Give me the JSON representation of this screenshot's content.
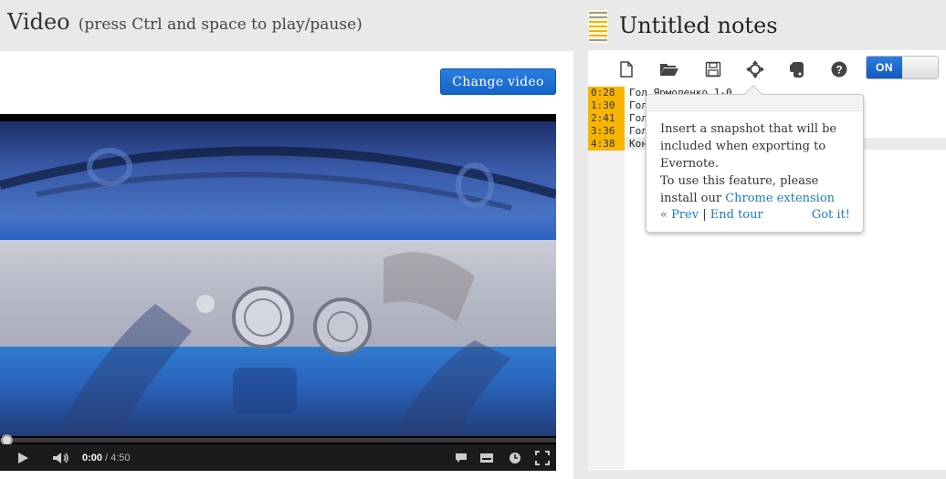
{
  "video": {
    "heading": "Video",
    "hint": "(press Ctrl and space to play/pause)",
    "change_button": "Change video",
    "player": {
      "progress": 0.0,
      "time_current": "0:00",
      "time_separator": "/",
      "time_total": "4:50",
      "icons": [
        "play-icon",
        "volume-icon",
        "captions-icon",
        "subtitles-icon",
        "settings-icon",
        "fullscreen-icon"
      ]
    }
  },
  "notes": {
    "title": "Untitled notes",
    "toolbar": {
      "icons": [
        "new-file-icon",
        "open-folder-icon",
        "save-icon",
        "snapshot-icon",
        "evernote-icon",
        "help-icon"
      ],
      "toggle_label": "ON",
      "toggle_state": "on"
    },
    "lines": [
      {
        "time": "0:28",
        "text": "Гол Ярмоленко 1-0"
      },
      {
        "time": "1:30",
        "text": "Гол"
      },
      {
        "time": "2:41",
        "text": "Гол"
      },
      {
        "time": "3:36",
        "text": "Гол"
      },
      {
        "time": "4:38",
        "text": "Кон"
      }
    ],
    "tooltip": {
      "text_1": "Insert a snapshot that will be included when exporting to Evernote.",
      "text_2": "To use this feature, please install our",
      "link": "Chrome extension",
      "prev": "« Prev",
      "separator": "|",
      "end_tour": "End tour",
      "got_it": "Got it!"
    }
  },
  "colors": {
    "accent_blue": "#1463c8",
    "timestamp_bg": "#f7b500",
    "link": "#1a7bbf"
  }
}
